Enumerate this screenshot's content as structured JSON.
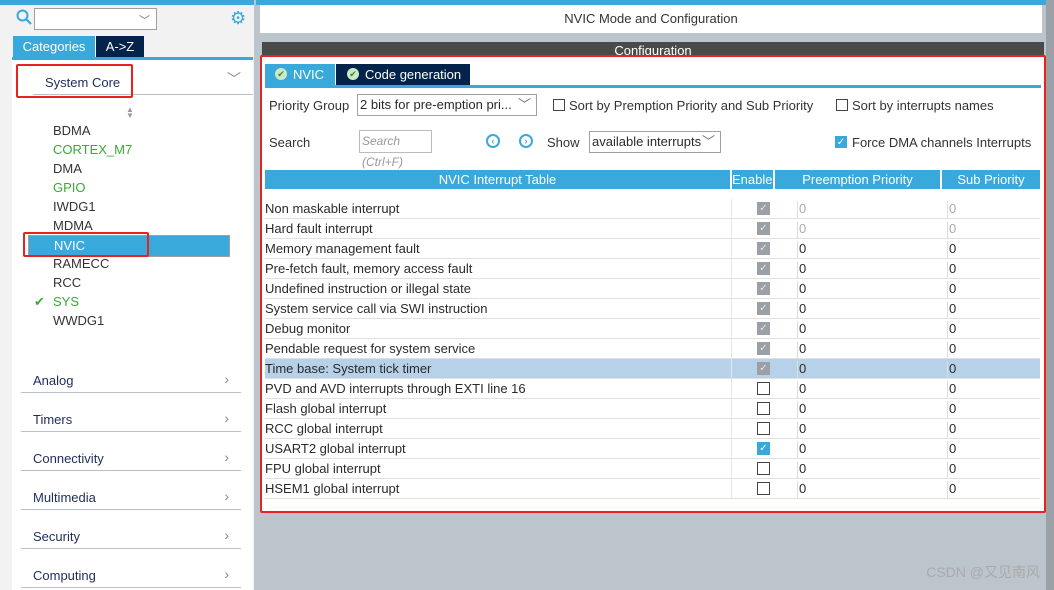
{
  "sidebar": {
    "search_value": "",
    "tabs": [
      "Categories",
      "A->Z"
    ],
    "expanded_category": "System Core",
    "items": [
      {
        "label": "BDMA",
        "state": "normal"
      },
      {
        "label": "CORTEX_M7",
        "state": "green"
      },
      {
        "label": "DMA",
        "state": "normal"
      },
      {
        "label": "GPIO",
        "state": "green"
      },
      {
        "label": "IWDG1",
        "state": "normal"
      },
      {
        "label": "MDMA",
        "state": "normal"
      },
      {
        "label": "NVIC",
        "state": "selected"
      },
      {
        "label": "RAMECC",
        "state": "normal"
      },
      {
        "label": "RCC",
        "state": "normal"
      },
      {
        "label": "SYS",
        "state": "checked"
      },
      {
        "label": "WWDG1",
        "state": "normal"
      }
    ],
    "categories": [
      "Analog",
      "Timers",
      "Connectivity",
      "Multimedia",
      "Security",
      "Computing"
    ]
  },
  "main": {
    "title": "NVIC Mode and Configuration",
    "config_label": "Configuration",
    "tabs": [
      "NVIC",
      "Code generation"
    ],
    "priority_group_label": "Priority Group",
    "priority_group_value": "2 bits for pre-emption pri...",
    "sort_premption_label": "Sort by Premption Priority and Sub Priority",
    "sort_names_label": "Sort by interrupts names",
    "search_label": "Search",
    "search_placeholder": "Search (Ctrl+F)",
    "show_label": "Show",
    "show_value": "available interrupts",
    "force_dma_label": "Force DMA channels Interrupts",
    "force_dma_checked": true,
    "table": {
      "headers": [
        "NVIC Interrupt Table",
        "Enabled",
        "Preemption Priority",
        "Sub Priority"
      ],
      "rows": [
        {
          "name": "Non maskable interrupt",
          "enabled": "fixed",
          "pre": "0",
          "sub": "0",
          "grey": true
        },
        {
          "name": "Hard fault interrupt",
          "enabled": "fixed",
          "pre": "0",
          "sub": "0",
          "grey": true
        },
        {
          "name": "Memory management fault",
          "enabled": "fixed",
          "pre": "0",
          "sub": "0"
        },
        {
          "name": "Pre-fetch fault, memory access fault",
          "enabled": "fixed",
          "pre": "0",
          "sub": "0"
        },
        {
          "name": "Undefined instruction or illegal state",
          "enabled": "fixed",
          "pre": "0",
          "sub": "0"
        },
        {
          "name": "System service call via SWI instruction",
          "enabled": "fixed",
          "pre": "0",
          "sub": "0"
        },
        {
          "name": "Debug monitor",
          "enabled": "fixed",
          "pre": "0",
          "sub": "0"
        },
        {
          "name": "Pendable request for system service",
          "enabled": "fixed",
          "pre": "0",
          "sub": "0"
        },
        {
          "name": "Time base: System tick timer",
          "enabled": "fixed",
          "pre": "0",
          "sub": "0",
          "highlight": true
        },
        {
          "name": "PVD and AVD interrupts through EXTI line 16",
          "enabled": "off",
          "pre": "0",
          "sub": "0"
        },
        {
          "name": "Flash global interrupt",
          "enabled": "off",
          "pre": "0",
          "sub": "0"
        },
        {
          "name": "RCC global interrupt",
          "enabled": "off",
          "pre": "0",
          "sub": "0"
        },
        {
          "name": "USART2 global interrupt",
          "enabled": "on",
          "pre": "0",
          "sub": "0"
        },
        {
          "name": "FPU global interrupt",
          "enabled": "off",
          "pre": "0",
          "sub": "0"
        },
        {
          "name": "HSEM1 global interrupt",
          "enabled": "off",
          "pre": "0",
          "sub": "0"
        }
      ]
    }
  },
  "watermark": "CSDN @又见南风",
  "colors": {
    "accent": "#39a9dc",
    "navy": "#03234b",
    "green": "#3aaa35",
    "annotation": "#e8231f"
  }
}
